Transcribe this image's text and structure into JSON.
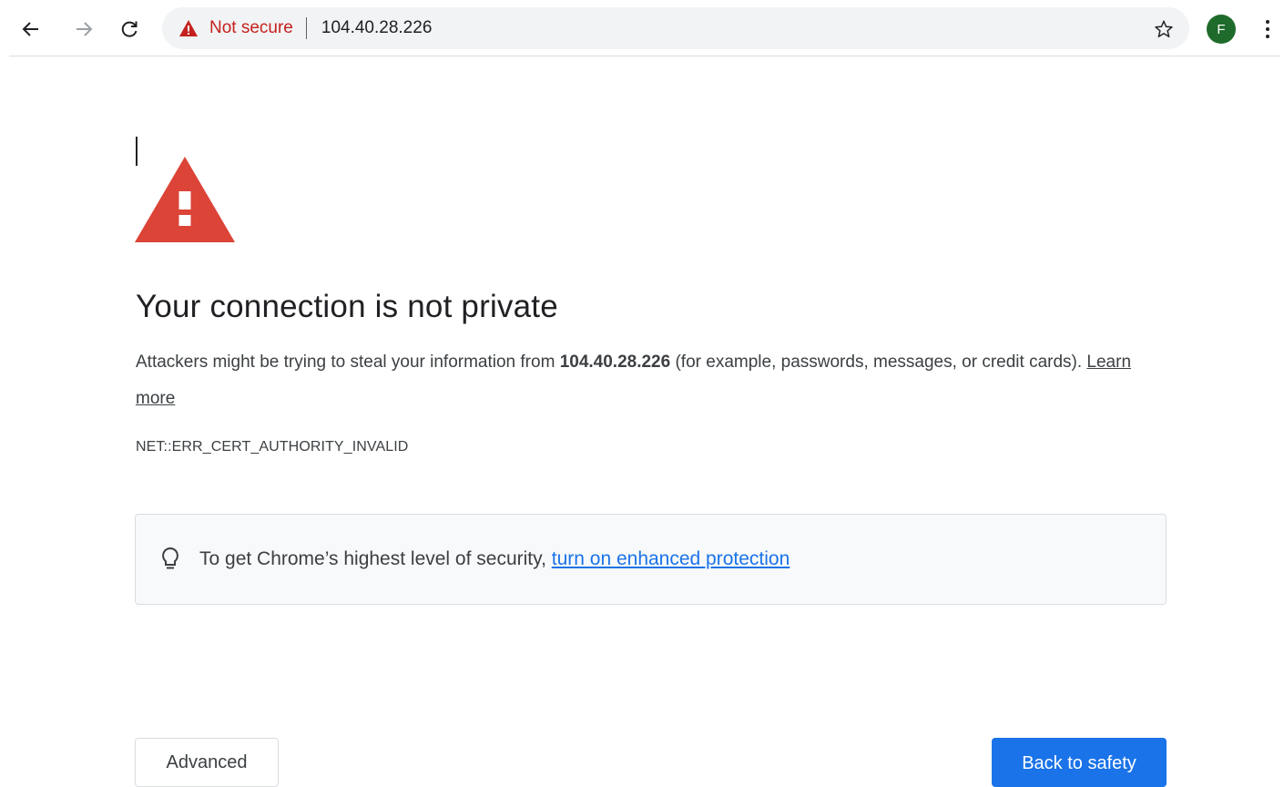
{
  "browser": {
    "back_icon": "arrow-left-icon",
    "forward_icon": "arrow-right-icon",
    "reload_icon": "reload-icon",
    "security_label": "Not secure",
    "security_color": "#c5221f",
    "url": "104.40.28.226",
    "bookmark_icon": "star-icon",
    "profile_initial": "F",
    "profile_color": "#1e6b2b",
    "menu_icon": "vertical-dots-icon"
  },
  "interstitial": {
    "warning_icon": "warning-triangle-icon",
    "warning_color": "#db4437",
    "heading": "Your connection is not private",
    "explanation_prefix": "Attackers might be trying to steal your information from ",
    "explanation_host": "104.40.28.226",
    "explanation_suffix": " (for example, passwords, messages, or credit cards). ",
    "learn_more": "Learn more",
    "error_code": "NET::ERR_CERT_AUTHORITY_INVALID",
    "protection": {
      "icon": "lightbulb-icon",
      "text": "To get Chrome’s highest level of security, ",
      "link": "turn on enhanced protection",
      "link_color": "#1a73e8"
    },
    "advanced_button": "Advanced",
    "back_to_safety_button": "Back to safety",
    "primary_color": "#1a73e8"
  }
}
